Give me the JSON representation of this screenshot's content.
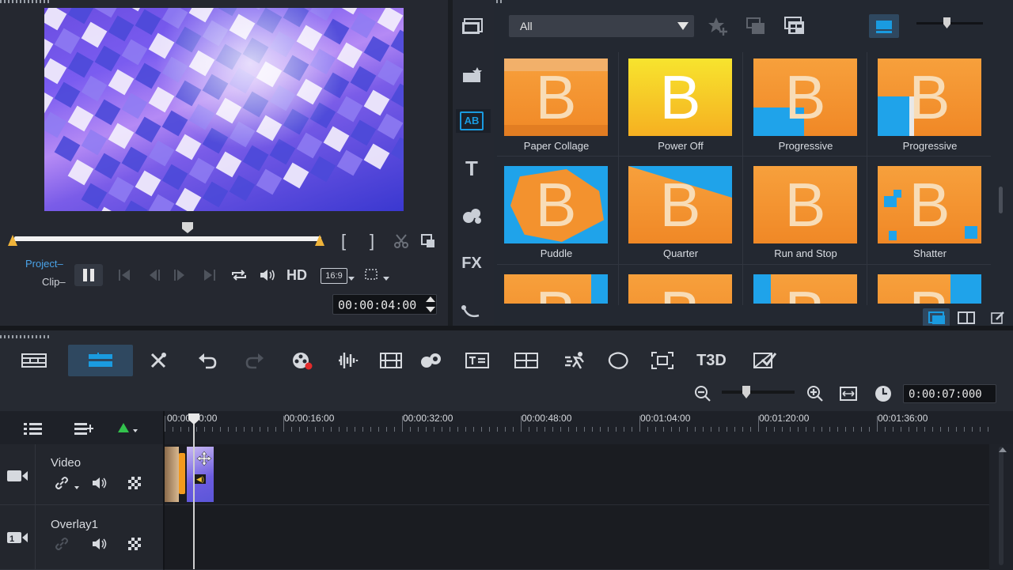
{
  "preview": {
    "mode_project": "Project",
    "mode_clip": "Clip",
    "timecode": "00:00:04:00",
    "hd_label": "HD",
    "aspect_label": "16:9",
    "mark_in_label": "[",
    "mark_out_label": "]"
  },
  "library": {
    "filter_value": "All",
    "side_fx_label": "FX",
    "side_title_label": "T",
    "side_transition_label": "AB",
    "items": [
      {
        "label": "Paper Collage"
      },
      {
        "label": "Power Off"
      },
      {
        "label": "Progressive"
      },
      {
        "label": "Progressive"
      },
      {
        "label": "Puddle"
      },
      {
        "label": "Quarter"
      },
      {
        "label": "Run and Stop"
      },
      {
        "label": "Shatter"
      }
    ],
    "thumb_letter": "B"
  },
  "timeline": {
    "total_timecode": "0:00:07:000",
    "ruler_labels": [
      "00:00:00:00",
      "00:00:16:00",
      "00:00:32:00",
      "00:00:48:00",
      "00:01:04:00",
      "00:01:20:00",
      "00:01:36:00"
    ],
    "tracks": [
      {
        "name": "Video"
      },
      {
        "name": "Overlay1"
      }
    ],
    "title3d_label": "T3D"
  },
  "colors": {
    "accent_blue": "#1a9be0",
    "thumb_orange": "#f39130",
    "trim_yellow": "#f0b43a",
    "record_red": "#e32b2b"
  }
}
